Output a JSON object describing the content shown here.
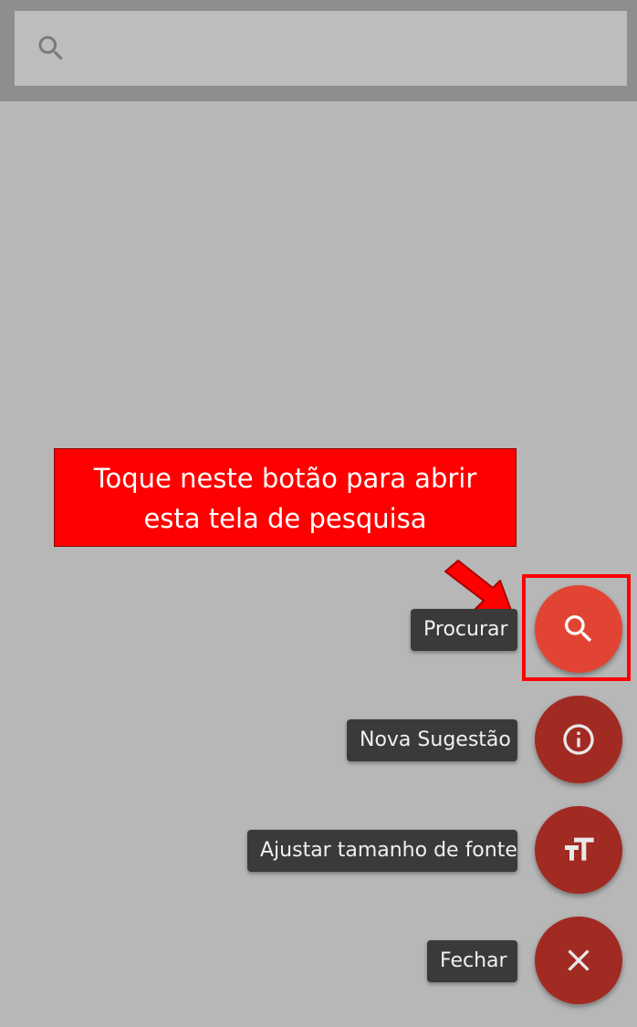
{
  "search": {
    "placeholder": "",
    "icon": "search-icon"
  },
  "callout": {
    "line1": "Toque neste botão para abrir",
    "line2": "esta tela de pesquisa",
    "background": "#ff0000"
  },
  "menu": {
    "items": [
      {
        "label": "Procurar",
        "icon": "search-icon",
        "color": "#e24434"
      },
      {
        "label": "Nova Sugestão",
        "icon": "info-icon",
        "color": "#a12a22"
      },
      {
        "label": "Ajustar tamanho de fonte",
        "icon": "text-size-icon",
        "color": "#a12a22"
      },
      {
        "label": "Fechar",
        "icon": "close-icon",
        "color": "#a12a22"
      }
    ]
  }
}
